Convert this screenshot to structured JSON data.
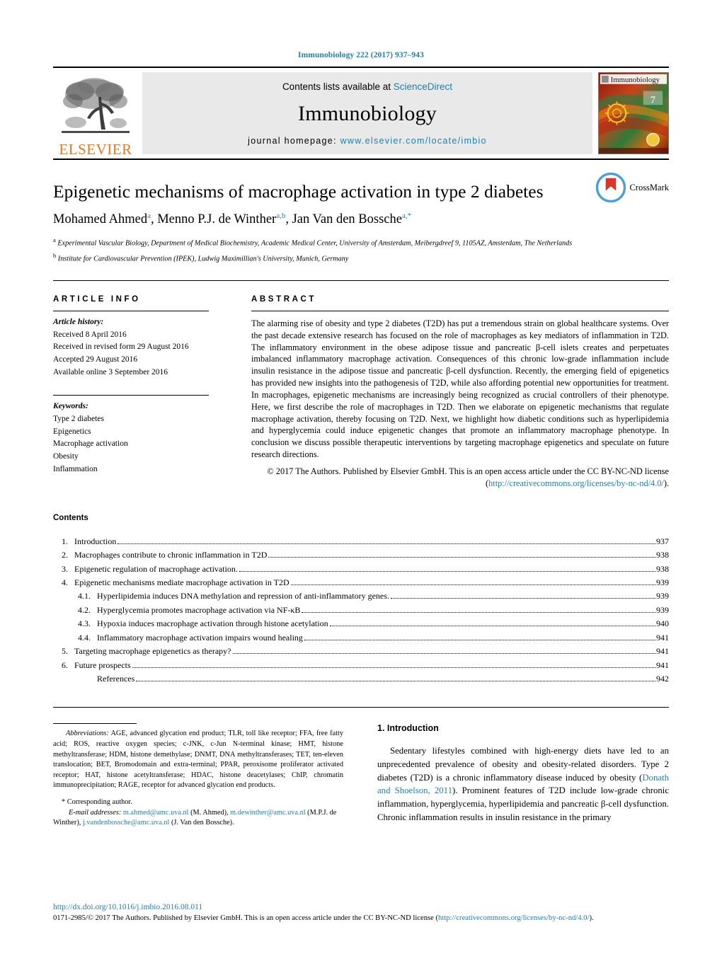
{
  "running_head": "Immunobiology 222 (2017) 937–943",
  "masthead": {
    "publisher": "ELSEVIER",
    "contents_prefix": "Contents lists available at ",
    "contents_link": "ScienceDirect",
    "journal_name": "Immunobiology",
    "homepage_prefix": "journal homepage: ",
    "homepage_link": "www.elsevier.com/locate/imbio",
    "cover_title": "Immunobiology"
  },
  "article": {
    "title": "Epigenetic mechanisms of macrophage activation in type 2 diabetes",
    "authors_html": "Mohamed Ahmed<sup>a</sup>, Menno P.J. de Winther<sup>a,b</sup>, Jan Van den Bossche<sup>a,*</sup>",
    "affiliation_a": "Experimental Vascular Biology, Department of Medical Biochemistry, Academic Medical Center, University of Amsterdam, Meibergdreef 9, 1105AZ, Amsterdam, The Netherlands",
    "affiliation_b": "Institute for Cardiovascular Prevention (IPEK), Ludwig Maximillian's University, Munich, Germany",
    "crossmark_label": "CrossMark"
  },
  "article_info": {
    "heading": "ARTICLE INFO",
    "history_label": "Article history:",
    "history": [
      "Received 8 April 2016",
      "Received in revised form 29 August 2016",
      "Accepted 29 August 2016",
      "Available online 3 September 2016"
    ],
    "keywords_label": "Keywords:",
    "keywords": [
      "Type 2 diabetes",
      "Epigenetics",
      "Macrophage activation",
      "Obesity",
      "Inflammation"
    ]
  },
  "abstract": {
    "heading": "ABSTRACT",
    "text": "The alarming rise of obesity and type 2 diabetes (T2D) has put a tremendous strain on global healthcare systems. Over the past decade extensive research has focused on the role of macrophages as key mediators of inflammation in T2D. The inflammatory environment in the obese adipose tissue and pancreatic β-cell islets creates and perpetuates imbalanced inflammatory macrophage activation. Consequences of this chronic low-grade inflammation include insulin resistance in the adipose tissue and pancreatic β-cell dysfunction. Recently, the emerging field of epigenetics has provided new insights into the pathogenesis of T2D, while also affording potential new opportunities for treatment. In macrophages, epigenetic mechanisms are increasingly being recognized as crucial controllers of their phenotype. Here, we first describe the role of macrophages in T2D. Then we elaborate on epigenetic mechanisms that regulate macrophage activation, thereby focusing on T2D. Next, we highlight how diabetic conditions such as hyperlipidemia and hyperglycemia could induce epigenetic changes that promote an inflammatory macrophage phenotype. In conclusion we discuss possible therapeutic interventions by targeting macrophage epigenetics and speculate on future research directions.",
    "copyright_pre": "© 2017 The Authors. Published by Elsevier GmbH. This is an open access article under the CC BY-NC-ND license (",
    "copyright_link": "http://creativecommons.org/licenses/by-nc-nd/4.0/",
    "copyright_post": ")."
  },
  "contents": {
    "heading": "Contents",
    "entries": [
      {
        "num": "1.",
        "label": "Introduction",
        "page": "937",
        "sub": false
      },
      {
        "num": "2.",
        "label": "Macrophages contribute to chronic inflammation in T2D",
        "page": "938",
        "sub": false
      },
      {
        "num": "3.",
        "label": "Epigenetic regulation of macrophage activation.",
        "page": "938",
        "sub": false
      },
      {
        "num": "4.",
        "label": "Epigenetic mechanisms mediate macrophage activation in T2D",
        "page": "939",
        "sub": false
      },
      {
        "num": "4.1.",
        "label": "Hyperlipidemia induces DNA methylation and repression of anti-inflammatory genes.",
        "page": "939",
        "sub": true
      },
      {
        "num": "4.2.",
        "label": "Hyperglycemia promotes macrophage activation via NF-κB",
        "page": "939",
        "sub": true
      },
      {
        "num": "4.3.",
        "label": "Hypoxia induces macrophage activation through histone acetylation",
        "page": "940",
        "sub": true
      },
      {
        "num": "4.4.",
        "label": "Inflammatory macrophage activation impairs wound healing",
        "page": "941",
        "sub": true
      },
      {
        "num": "5.",
        "label": "Targeting macrophage epigenetics as therapy?",
        "page": "941",
        "sub": false
      },
      {
        "num": "6.",
        "label": "Future prospects",
        "page": "941",
        "sub": false
      },
      {
        "num": "",
        "label": "References",
        "page": "942",
        "sub": true
      }
    ]
  },
  "footnotes": {
    "abbrev_label": "Abbreviations:",
    "abbrev_text": "AGE, advanced glycation end product; TLR, toll like receptor; FFA, free fatty acid; ROS, reactive oxygen species; c-JNK, c-Jun N-terminal kinase; HMT, histone methyltransferase; HDM, histone demethylase; DNMT, DNA methyltransferases; TET, ten-eleven translocation; BET, Bromodomain and extra-terminal; PPAR, peroxisome proliferator activated receptor; HAT, histone acetyltransferase; HDAC, histone deacetylases; ChIP, chromatin immunoprecipitation; RAGE, receptor for advanced glycation end products.",
    "corresponding": "* Corresponding author.",
    "email_label": "E-mail addresses:",
    "emails": [
      {
        "address": "m.ahmed@amc.uva.nl",
        "owner": "(M. Ahmed)"
      },
      {
        "address": "m.dewinther@amc.uva.nl",
        "owner": "(M.P.J. de Winther)"
      },
      {
        "address": "j.vandenbossche@amc.uva.nl",
        "owner": "(J. Van den Bossche)"
      }
    ]
  },
  "introduction": {
    "heading": "1. Introduction",
    "paragraph_pre": "Sedentary lifestyles combined with high-energy diets have led to an unprecedented prevalence of obesity and obesity-related disorders. Type 2 diabetes (T2D) is a chronic inflammatory disease induced by obesity (",
    "citation": "Donath and Shoelson, 2011",
    "paragraph_post": "). Prominent features of T2D include low-grade chronic inflammation, hyperglycemia, hyperlipidemia and pancreatic β-cell dysfunction. Chronic inflammation results in insulin resistance in the primary"
  },
  "footer": {
    "doi": "http://dx.doi.org/10.1016/j.imbio.2016.08.011",
    "license_pre": "0171-2985/© 2017 The Authors. Published by Elsevier GmbH. This is an open access article under the CC BY-NC-ND license (",
    "license_link": "http://creativecommons.org/licenses/by-nc-nd/4.0/",
    "license_post": ")."
  },
  "colors": {
    "link": "#1f7faa",
    "elsevier_orange": "#E87722",
    "crossmark_red": "#D8362A",
    "crossmark_blue": "#4C9FD4"
  }
}
